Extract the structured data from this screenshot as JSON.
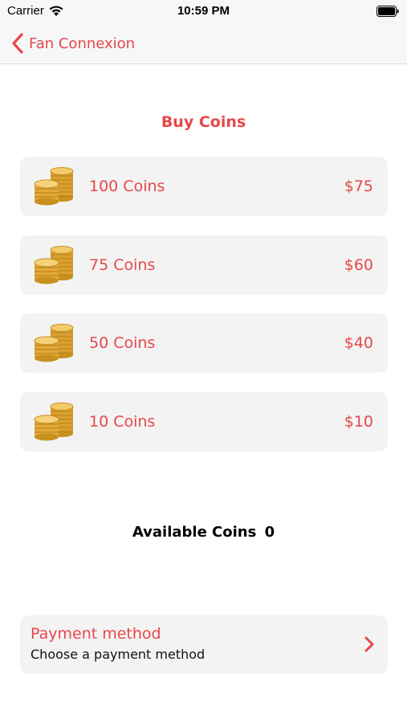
{
  "status_bar": {
    "carrier": "Carrier",
    "time": "10:59 PM",
    "icons": [
      "wifi-icon",
      "battery-icon"
    ]
  },
  "nav": {
    "back_label": "Fan Connexion",
    "back_icon": "chevron-left-icon"
  },
  "page": {
    "title": "Buy Coins"
  },
  "coin_packages": [
    {
      "label": "100 Coins",
      "price": "$75",
      "icon": "coin-stack-icon"
    },
    {
      "label": "75 Coins",
      "price": "$60",
      "icon": "coin-stack-icon"
    },
    {
      "label": "50 Coins",
      "price": "$40",
      "icon": "coin-stack-icon"
    },
    {
      "label": "10 Coins",
      "price": "$10",
      "icon": "coin-stack-icon"
    }
  ],
  "available": {
    "label": "Available Coins",
    "count": "0"
  },
  "payment": {
    "title": "Payment method",
    "subtitle": "Choose a payment method",
    "icon": "chevron-right-icon"
  },
  "colors": {
    "accent": "#e8474a",
    "row_background": "#f3f3f3",
    "coin_gold": "#e0a93a"
  }
}
